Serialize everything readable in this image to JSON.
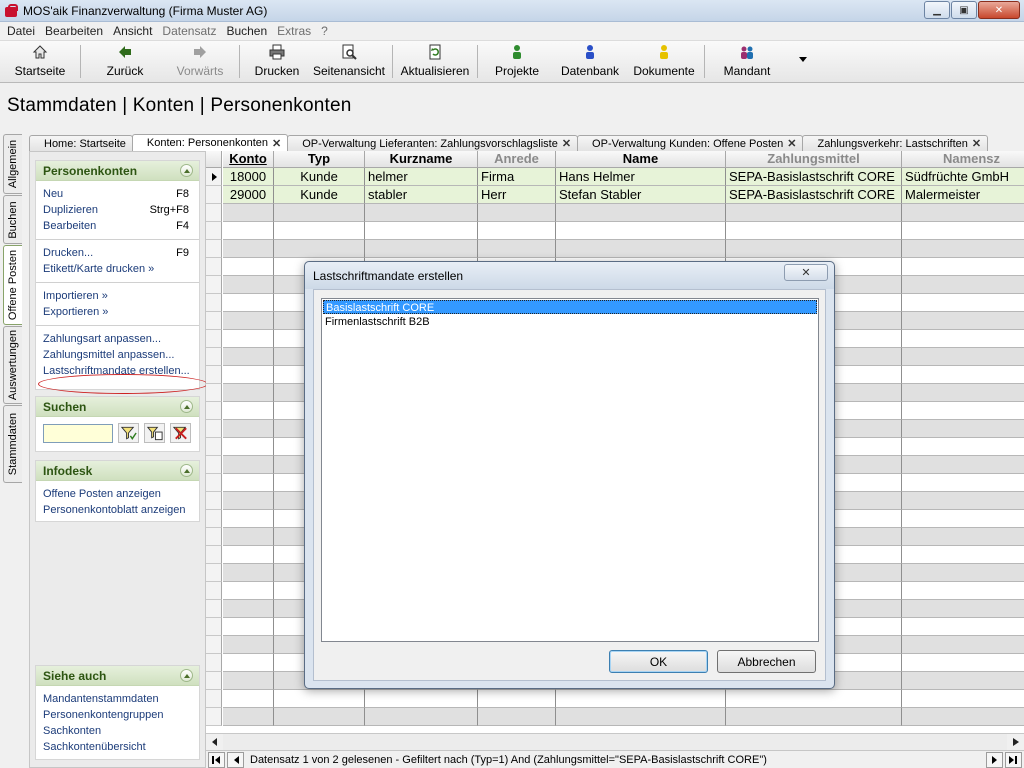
{
  "window": {
    "title": "MOS'aik Finanzverwaltung (Firma Muster AG)",
    "minimize": "▁",
    "maximize": "▣",
    "close": "✕"
  },
  "menu": [
    "Datei",
    "Bearbeiten",
    "Ansicht",
    "Datensatz",
    "Buchen",
    "Extras",
    "?"
  ],
  "toolbar": {
    "start": "Startseite",
    "back": "Zurück",
    "forward": "Vorwärts",
    "print": "Drucken",
    "preview": "Seitenansicht",
    "refresh": "Aktualisieren",
    "projects": "Projekte",
    "database": "Datenbank",
    "documents": "Dokumente",
    "client": "Mandant"
  },
  "page_title": "Stammdaten | Konten | Personenkonten",
  "vertical_tabs": [
    "Allgemein",
    "Buchen",
    "Offene Posten",
    "Auswertungen",
    "Stammdaten"
  ],
  "tabs": [
    {
      "label": "Home: Startseite",
      "close": ""
    },
    {
      "label": "Konten: Personenkonten",
      "close": "✕"
    },
    {
      "label": "OP-Verwaltung Lieferanten: Zahlungsvorschlagsliste",
      "close": "✕"
    },
    {
      "label": "OP-Verwaltung Kunden: Offene Posten",
      "close": "✕"
    },
    {
      "label": "Zahlungsverkehr: Lastschriften",
      "close": "✕"
    }
  ],
  "panel": {
    "personenkonten_title": "Personenkonten",
    "items": {
      "neu": "Neu",
      "neu_sc": "F8",
      "dup": "Duplizieren",
      "dup_sc": "Strg+F8",
      "edit": "Bearbeiten",
      "edit_sc": "F4",
      "print": "Drucken...",
      "print_sc": "F9",
      "label": "Etikett/Karte drucken »",
      "import": "Importieren »",
      "export": "Exportieren »",
      "zahlungsart": "Zahlungsart anpassen...",
      "zahlungsmittel": "Zahlungsmittel anpassen...",
      "mandate": "Lastschriftmandate erstellen..."
    },
    "suchen_title": "Suchen",
    "search_value": "",
    "infodesk_title": "Infodesk",
    "infodesk": [
      "Offene Posten anzeigen",
      "Personenkontoblatt anzeigen"
    ],
    "siehe_title": "Siehe auch",
    "siehe": [
      "Mandantenstammdaten",
      "Personenkontengruppen",
      "Sachkonten",
      "Sachkontenübersicht"
    ]
  },
  "grid": {
    "headers": [
      "Konto",
      "Typ",
      "Kurzname",
      "Anrede",
      "Name",
      "Zahlungsmittel",
      "Namensz"
    ],
    "rows": [
      [
        "18000",
        "Kunde",
        "helmer",
        "Firma",
        "Hans Helmer",
        "SEPA-Basislastschrift CORE",
        "Südfrüchte GmbH"
      ],
      [
        "29000",
        "Kunde",
        "stabler",
        "Herr",
        "Stefan Stabler",
        "SEPA-Basislastschrift CORE",
        "Malermeister"
      ]
    ]
  },
  "status": "Datensatz 1 von 2 gelesenen - Gefiltert nach (Typ=1) And (Zahlungsmittel=\"SEPA-Basislastschrift CORE\")",
  "dialog": {
    "title": "Lastschriftmandate erstellen",
    "close": "✕",
    "options": [
      "Basislastschrift CORE",
      "Firmenlastschrift B2B"
    ],
    "ok": "OK",
    "cancel": "Abbrechen"
  }
}
